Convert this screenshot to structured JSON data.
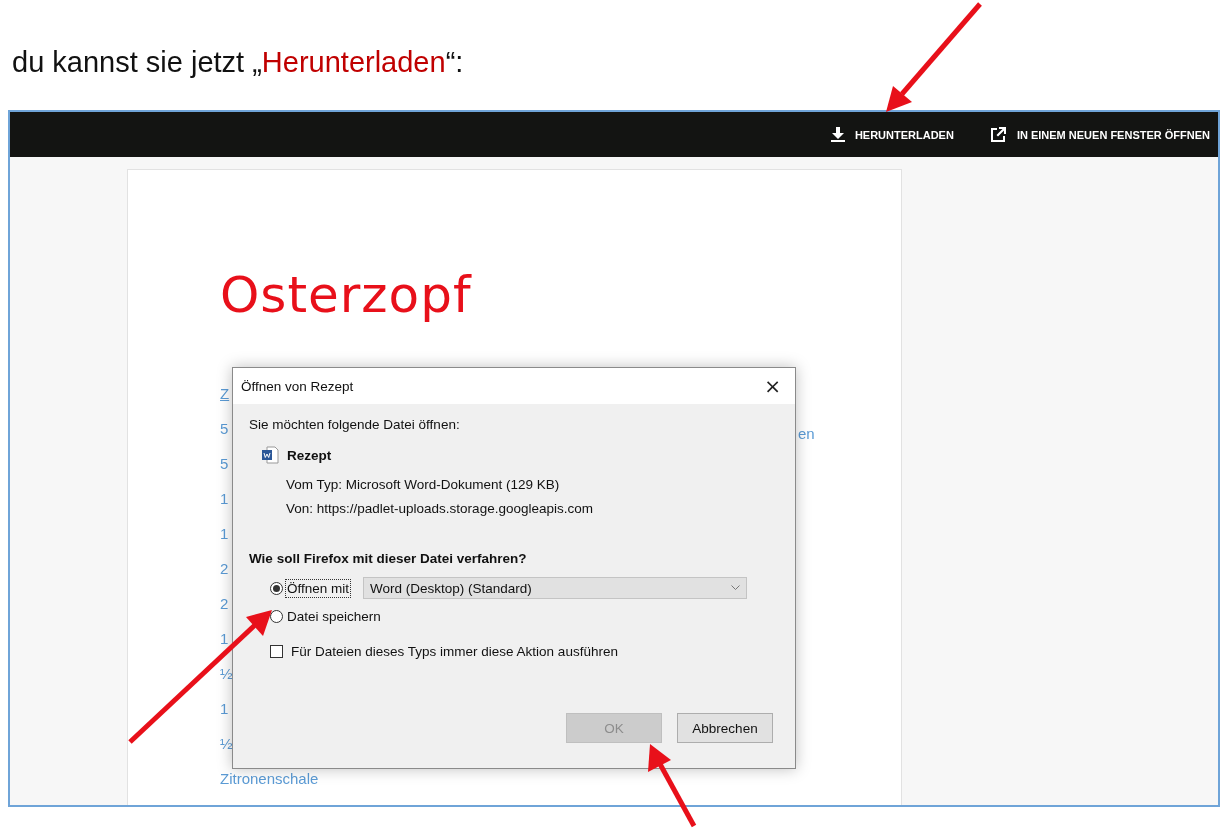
{
  "instruction": {
    "before": "du kannst sie jetzt „",
    "highlight": "Herunterladen",
    "after": "“:"
  },
  "toolbar": {
    "actions": [
      {
        "kind": "download",
        "label": "HERUNTERLADEN"
      },
      {
        "kind": "open_window",
        "label": "IN EINEM NEUEN FENSTER ÖFFNEN"
      }
    ]
  },
  "document": {
    "title": "Osterzopf",
    "ingredient_fragments": [
      "Z",
      "5",
      "5",
      "1",
      "1",
      "2",
      "2",
      "1",
      "½",
      "1",
      "½"
    ],
    "ingredient_last": "Zitronenschale",
    "right_fragment": "en"
  },
  "dialog": {
    "title": "Öffnen von Rezept",
    "close": "×",
    "intro": "Sie möchten folgende Datei öffnen:",
    "file_name": "Rezept",
    "file_type": "Vom Typ: Microsoft Word-Dokument (129 KB)",
    "file_source": "Von: https://padlet-uploads.storage.googleapis.com",
    "question": "Wie soll Firefox mit dieser Datei verfahren?",
    "options": [
      {
        "label": "Öffnen mit",
        "selected": true,
        "focused": true,
        "app": "Word (Desktop) (Standard)"
      },
      {
        "label": "Datei speichern",
        "selected": false,
        "focused": false
      }
    ],
    "remember": {
      "label": "Für Dateien dieses Typs immer diese Aktion ausführen",
      "checked": false
    },
    "buttons": [
      {
        "label": "OK",
        "disabled": true
      },
      {
        "label": "Abbrechen",
        "disabled": false
      }
    ]
  }
}
